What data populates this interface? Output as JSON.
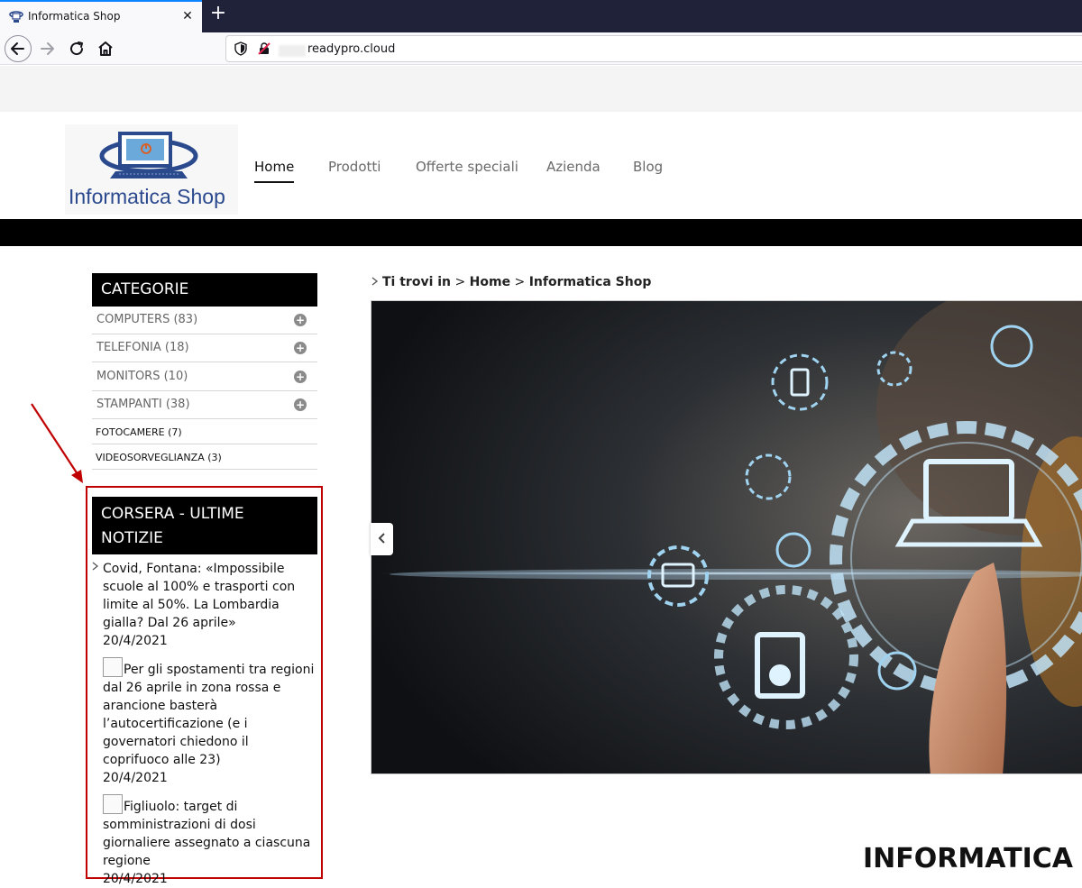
{
  "browser": {
    "tab_title": "Informatica Shop",
    "url": "readypro.cloud",
    "new_tab_label": "+",
    "close_tab_label": "✕"
  },
  "site": {
    "logo_text": "Informatica Shop",
    "menu": [
      "Home",
      "Prodotti",
      "Offerte speciali",
      "Azienda",
      "Blog"
    ],
    "breadcrumb": {
      "prefix": "Ti trovi in",
      "items": [
        "Home",
        "Informatica Shop"
      ],
      "separator": ">"
    },
    "page_heading": "INFORMATICA SH"
  },
  "categories": {
    "title": "CATEGORIE",
    "items": [
      {
        "label": "COMPUTERS (83)"
      },
      {
        "label": "TELEFONIA (18)"
      },
      {
        "label": "MONITORS (10)"
      },
      {
        "label": "STAMPANTI (38)"
      },
      {
        "label": "FOTOCAMERE (7)"
      },
      {
        "label": "VIDEOSORVEGLIANZA (3)"
      }
    ]
  },
  "news": {
    "title": "CORSERA - ULTIME NOTIZIE",
    "items": [
      {
        "text": "Covid, Fontana: «Impossibile scuole al 100% e trasporti con limite al 50%. La Lombardia gialla? Dal 26 aprile»",
        "date": "20/4/2021"
      },
      {
        "text": "Per gli spostamenti tra regioni dal 26 aprile in zona rossa e arancione basterà l’autocertificazione (e i governatori chiedono il coprifuoco alle 23)",
        "date": "20/4/2021"
      },
      {
        "text": "Figliuolo: target di somministrazioni di dosi giornaliere assegnato a ciascuna regione",
        "date": "20/4/2021"
      }
    ]
  },
  "colors": {
    "accent_red": "#c00000",
    "tab_accent": "#0a84ff",
    "logo_blue": "#2b4a8e",
    "logo_orange": "#e05a1a"
  }
}
